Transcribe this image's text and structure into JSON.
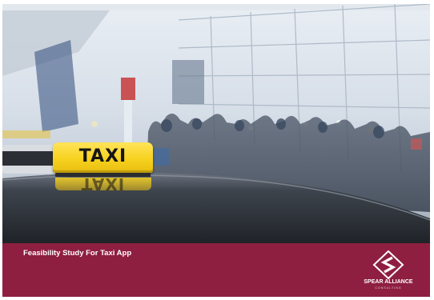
{
  "slide": {
    "taxi_sign_text": "TAXI",
    "subtitle": "Feasibility Study For Taxi App",
    "logo": {
      "name": "SPEAR ALLIANCE",
      "tagline": "CONSULTING"
    }
  },
  "colors": {
    "banner": "#8e1f41",
    "taxi_yellow": "#f7d21f",
    "car_roof": "#3b4048"
  },
  "icons": {
    "taxi_sign": "taxi-sign-icon",
    "logo": "spear-alliance-logo-icon"
  }
}
